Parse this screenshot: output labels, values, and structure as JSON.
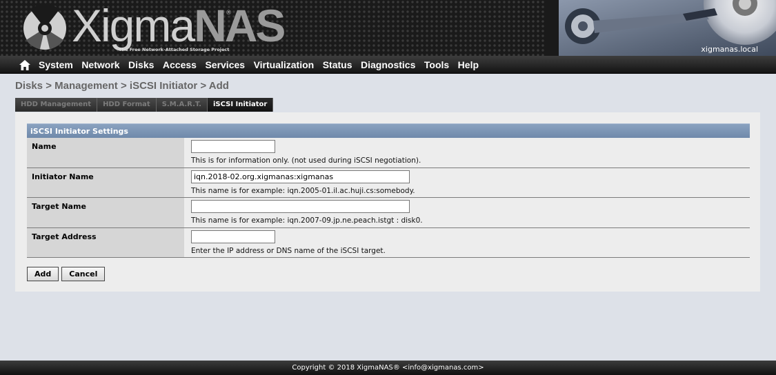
{
  "header": {
    "logo_text_light": "Xigma",
    "logo_text_dark": "NAS",
    "logo_registered": "®",
    "tagline": "The Free Network-Attached Storage Project",
    "hostname": "xigmanas.local"
  },
  "nav": {
    "home_icon": "home-icon",
    "items": [
      "System",
      "Network",
      "Disks",
      "Access",
      "Services",
      "Virtualization",
      "Status",
      "Diagnostics",
      "Tools",
      "Help"
    ]
  },
  "breadcrumb": "Disks > Management > iSCSI Initiator > Add",
  "tabs": [
    {
      "label": "HDD Management",
      "active": false
    },
    {
      "label": "HDD Format",
      "active": false
    },
    {
      "label": "S.M.A.R.T.",
      "active": false
    },
    {
      "label": "iSCSI Initiator",
      "active": true
    }
  ],
  "form": {
    "section_title": "iSCSI Initiator Settings",
    "rows": [
      {
        "label": "Name",
        "value": "",
        "hint": "This is for information only. (not used during iSCSI negotiation)."
      },
      {
        "label": "Initiator Name",
        "value": "iqn.2018-02.org.xigmanas:xigmanas",
        "hint": "This name is for example: iqn.2005-01.il.ac.huji.cs:somebody."
      },
      {
        "label": "Target Name",
        "value": "",
        "hint": "This name is for example: iqn.2007-09.jp.ne.peach.istgt : disk0."
      },
      {
        "label": "Target Address",
        "value": "",
        "hint": "Enter the IP address or DNS name of the iSCSI target."
      }
    ],
    "add_label": "Add",
    "cancel_label": "Cancel"
  },
  "footer": "Copyright © 2018 XigmaNAS® <info@xigmanas.com>"
}
